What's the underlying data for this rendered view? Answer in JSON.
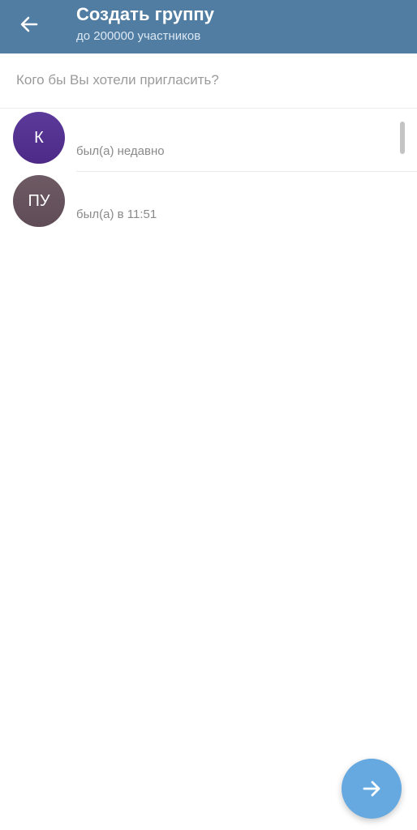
{
  "header": {
    "title": "Создать группу",
    "subtitle": "до 200000 участников",
    "back_icon": "arrow-left-icon",
    "background_color": "#517da2"
  },
  "search": {
    "placeholder": "Кого бы Вы хотели пригласить?",
    "value": ""
  },
  "contacts": [
    {
      "initials": "К",
      "name": "",
      "status": "был(а) недавно"
    },
    {
      "initials": "ПУ",
      "name": "",
      "status": "был(а) в 11:51"
    }
  ],
  "fab": {
    "icon": "arrow-right-icon",
    "color": "#65a9e0"
  }
}
